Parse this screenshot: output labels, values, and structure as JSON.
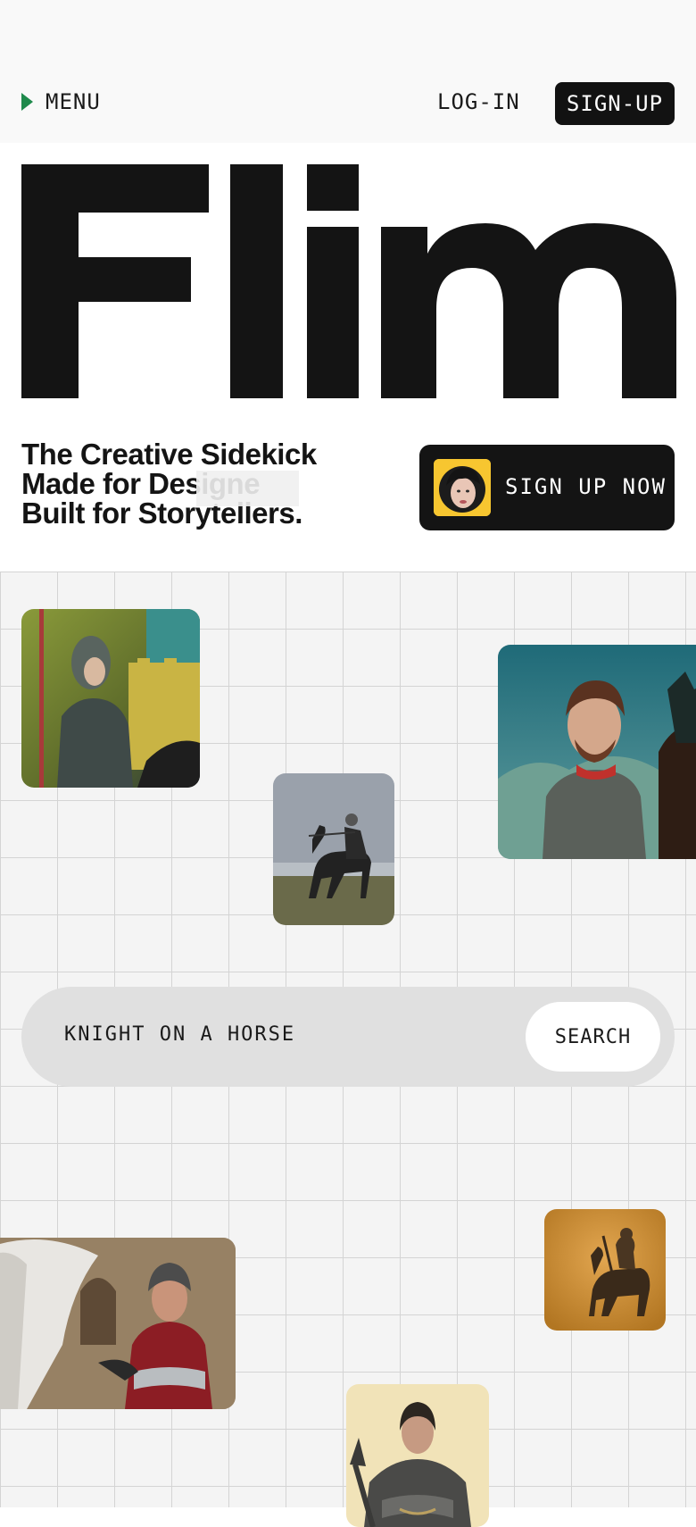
{
  "header": {
    "menu_label": "MENU",
    "login_label": "LOG-IN",
    "signup_label": "SIGN-UP"
  },
  "hero": {
    "logo_text": "Flim",
    "tagline_lines": [
      "The Creative Sidekick",
      "Made for Designe",
      "Built for Storytellers."
    ],
    "cta_label": "SIGN UP NOW"
  },
  "search": {
    "query": "KNIGHT ON A HORSE",
    "button_label": "SEARCH"
  },
  "colors": {
    "accent_green": "#1f8a4c",
    "dark": "#141414",
    "avatar_yellow": "#f7c630"
  },
  "icons": {
    "menu": "play-triangle-icon"
  }
}
